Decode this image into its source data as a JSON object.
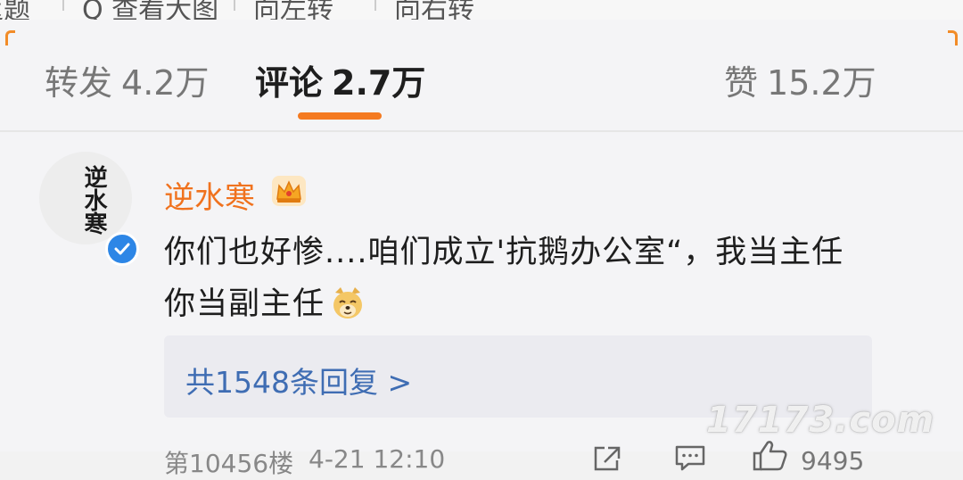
{
  "toolbar": {
    "items": [
      "返题",
      "Q 查看大图",
      "向左转",
      "向右转"
    ]
  },
  "tabs": {
    "repost": {
      "label": "转发",
      "count": "4.2万"
    },
    "comment": {
      "label": "评论",
      "count": "2.7万"
    },
    "like": {
      "label": "赞",
      "count": "15.2万"
    }
  },
  "comment": {
    "avatar_text": "逆水寒",
    "username": "逆水寒",
    "text": "你们也好惨....咱们成立'抗鹅办公室“，我当主任你当副主任",
    "replies_label": "共1548条回复 >",
    "floor": "第10456楼",
    "time": "4-21 12:10",
    "like_count": "9495"
  },
  "watermark": "17173.com",
  "colors": {
    "accent": "#f47a20",
    "username": "#f0721e",
    "link": "#3f6db3",
    "verified": "#2d86e6"
  }
}
